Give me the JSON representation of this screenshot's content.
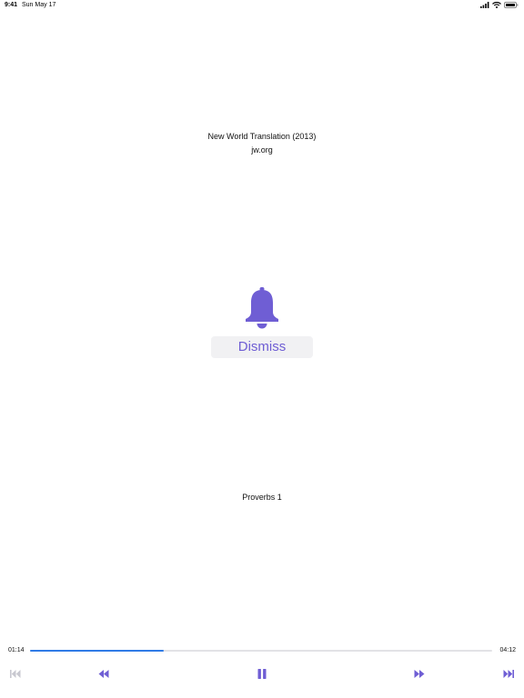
{
  "status_bar": {
    "time": "9:41",
    "date": "Sun May 17",
    "icons": [
      "signal-icon",
      "wifi-icon",
      "battery-icon"
    ]
  },
  "header": {
    "title": "New World Translation (2013)",
    "site": "jw.org"
  },
  "alarm": {
    "icon": "bell-icon",
    "dismiss_label": "Dismiss"
  },
  "chapter": {
    "label": "Proverbs 1"
  },
  "player": {
    "elapsed": "01:14",
    "total": "04:12",
    "progress_fraction": 0.29,
    "controls": [
      "skip-back-icon",
      "rewind-icon",
      "pause-icon",
      "fast-forward-icon",
      "skip-forward-icon"
    ]
  },
  "colors": {
    "accent": "#6f5ed4",
    "progress": "#2f7be6",
    "disabled": "#c8c8d0",
    "button_bg": "#f1f1f3"
  }
}
